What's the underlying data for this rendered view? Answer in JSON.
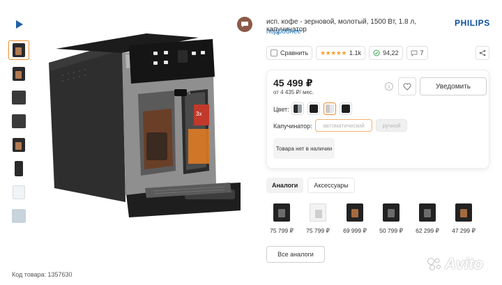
{
  "product": {
    "title": "исп. кофе - зерновой, молотый, 1500 Вт, 1.8 л, капучинатор",
    "more_link": "подробнее",
    "brand": "PHILIPS",
    "code_label": "Код товара: 1357630",
    "screen_text": "3x",
    "machine_brand": "PHILIPS"
  },
  "stats": {
    "compare_label": "Сравнить",
    "rating_stars": "★★★★★",
    "rating_count": "1.1k",
    "reliability": "94,22",
    "comments": "7"
  },
  "buy": {
    "price": "45 499 ₽",
    "installment": "от 4 435 ₽/ мес.",
    "notify_label": "Уведомить",
    "color_label": "Цвет:",
    "cappuccinator_label": "Капучинатор:",
    "option_auto": "автоматический",
    "option_manual": "ручной",
    "stock_status": "Товара нет в наличии"
  },
  "tabs": [
    {
      "label": "Аналоги",
      "active": true
    },
    {
      "label": "Аксессуары",
      "active": false
    }
  ],
  "analogs": [
    {
      "price": "75 799 ₽",
      "variant": "dark"
    },
    {
      "price": "75 799 ₽",
      "variant": "white"
    },
    {
      "price": "69 999 ₽",
      "variant": "copper"
    },
    {
      "price": "50 799 ₽",
      "variant": "dark"
    },
    {
      "price": "62 299 ₽",
      "variant": "dark"
    },
    {
      "price": "47 299 ₽",
      "variant": "copper"
    }
  ],
  "all_analogs_label": "Все аналоги",
  "watermark": "Avito",
  "colors": {
    "accent": "#f08c2a",
    "link": "#1f73b7",
    "brand": "#0a4f9e",
    "star": "#f2a134"
  }
}
